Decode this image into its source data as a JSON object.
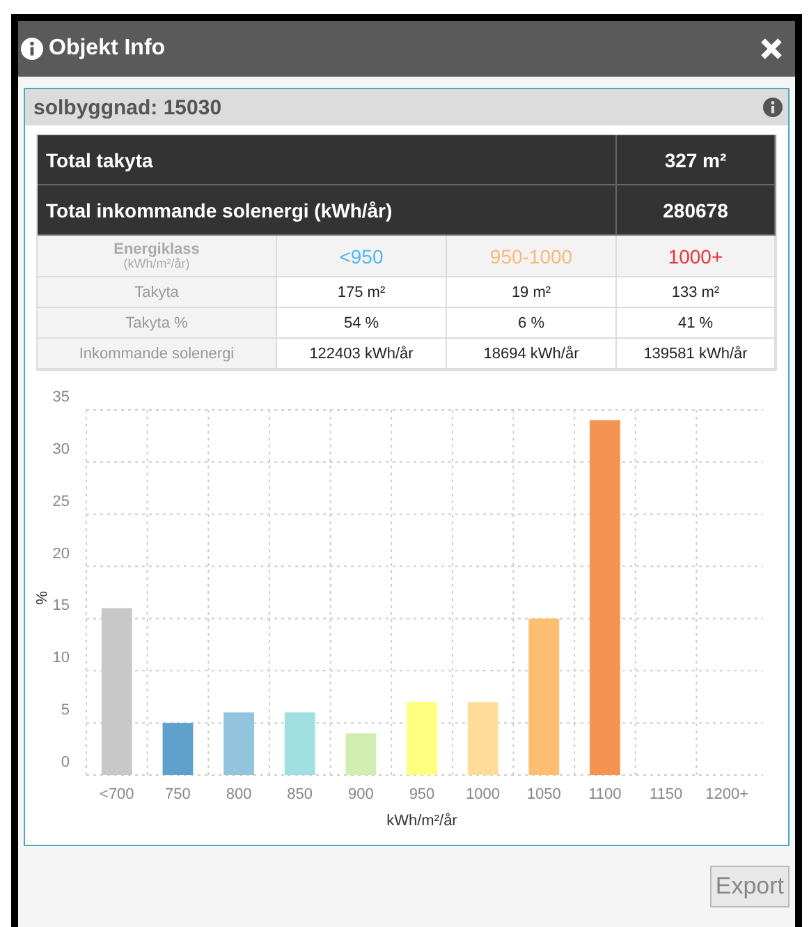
{
  "window": {
    "title": "Objekt Info"
  },
  "panel": {
    "title": "solbyggnad: 15030"
  },
  "summary": [
    {
      "label": "Total takyta",
      "value": "327 m²"
    },
    {
      "label": "Total inkommande solenergi (kWh/år)",
      "value": "280678"
    }
  ],
  "classes": {
    "label": "Energiklass",
    "unit": "(kWh/m²/år)",
    "items": [
      {
        "label": "<950",
        "color": "#4db8f0"
      },
      {
        "label": "950-1000",
        "color": "#f8b878"
      },
      {
        "label": "1000+",
        "color": "#e8333a"
      }
    ]
  },
  "rows": [
    {
      "label": "Takyta",
      "cells": [
        "175 m²",
        "19 m²",
        "133 m²"
      ]
    },
    {
      "label": "Takyta %",
      "cells": [
        "54 %",
        "6 %",
        "41 %"
      ]
    },
    {
      "label": "Inkommande solenergi",
      "cells": [
        "122403 kWh/år",
        "18694 kWh/år",
        "139581 kWh/år"
      ]
    }
  ],
  "chart": {
    "bars": [
      {
        "color": "#c8c8c8"
      },
      {
        "color": "#5fa0cc"
      },
      {
        "color": "#92c4de"
      },
      {
        "color": "#a0e0e0"
      },
      {
        "color": "#d0eeb0"
      },
      {
        "color": "#ffff80"
      },
      {
        "color": "#ffdd99"
      },
      {
        "color": "#fdbe70"
      },
      {
        "color": "#f59352"
      }
    ],
    "chart_data": {
      "type": "bar",
      "xlabel": "kWh/m²/år",
      "ylabel": "%",
      "categories": [
        "<700",
        "750",
        "800",
        "850",
        "900",
        "950",
        "1000",
        "1050",
        "1100",
        "1150",
        "1200+"
      ],
      "series": [
        {
          "values": [
            16,
            5,
            6,
            6,
            4,
            7,
            7,
            15,
            34,
            null,
            null
          ]
        }
      ],
      "ylim": [
        0,
        35
      ],
      "yticks": [
        0,
        5,
        10,
        15,
        20,
        25,
        30,
        35
      ],
      "grid": true
    }
  },
  "buttons": [
    {
      "label": "Export",
      "disabled": true
    }
  ]
}
